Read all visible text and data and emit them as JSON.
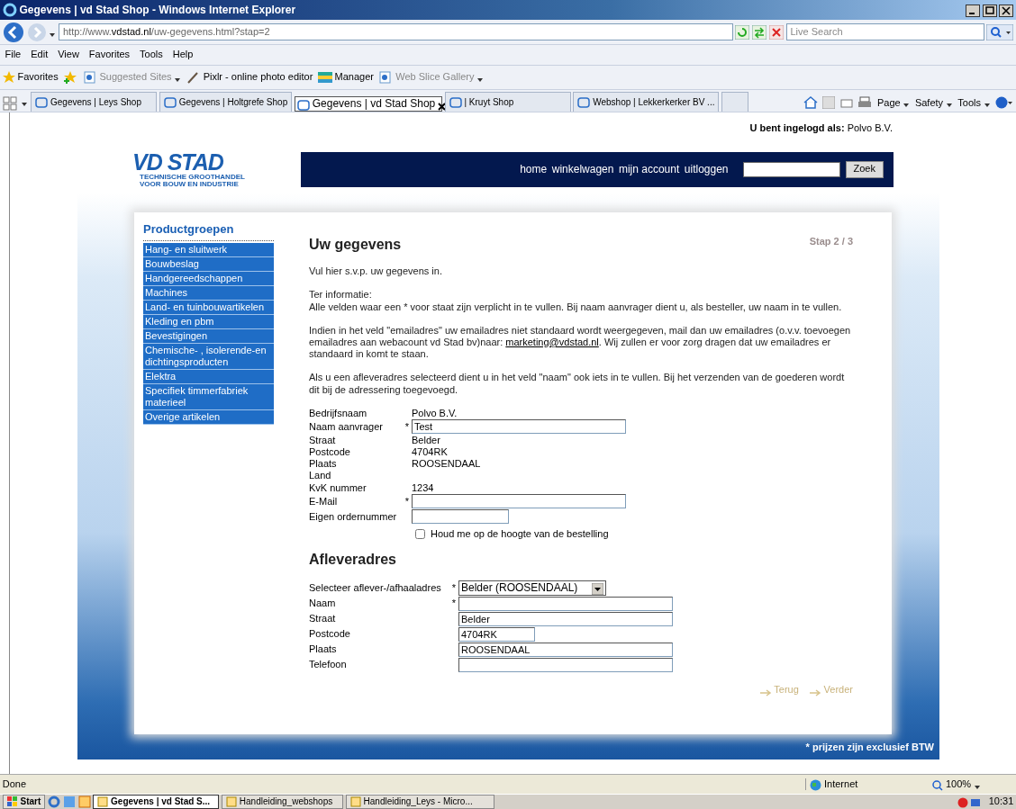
{
  "window": {
    "title": "Gegevens | vd Stad Shop - Windows Internet Explorer"
  },
  "address_bar": {
    "url": "http://www.**vdstad.nl**/uw-gegevens.html?stap=2",
    "search_placeholder": "Live Search"
  },
  "menu": [
    "File",
    "Edit",
    "View",
    "Favorites",
    "Tools",
    "Help"
  ],
  "favorites_bar": {
    "label": "Favorites",
    "items": [
      {
        "label": "Suggested Sites",
        "dropdown": true,
        "dimmed": true
      },
      {
        "label": "Pixlr - online photo editor",
        "dropdown": false,
        "dimmed": false
      },
      {
        "label": "Manager",
        "dropdown": false,
        "dimmed": false
      },
      {
        "label": "Web Slice Gallery",
        "dropdown": true,
        "dimmed": true
      }
    ]
  },
  "tabs": [
    {
      "label": "Gegevens | Leys Shop",
      "selected": false
    },
    {
      "label": "Gegevens | Holtgrefe Shop",
      "selected": false
    },
    {
      "label": "Gegevens | vd Stad Shop",
      "selected": true
    },
    {
      "label": "| Kruyt Shop",
      "selected": false
    },
    {
      "label": "Webshop | Lekkerkerker BV ...",
      "selected": false
    }
  ],
  "command_bar": [
    "Page",
    "Safety",
    "Tools"
  ],
  "page": {
    "login_label": "U bent ingelogd als:",
    "login_user": "Polvo B.V.",
    "logo": {
      "name": "VD STAD",
      "tagline_1": "TECHNISCHE GROOTHANDEL",
      "tagline_2": "VOOR BOUW EN INDUSTRIE"
    },
    "nav": [
      "home",
      "winkelwagen",
      "mijn account",
      "uitloggen"
    ],
    "search_button": "Zoek",
    "sidebar": {
      "title": "Productgroepen",
      "items": [
        "Hang- en sluitwerk",
        "Bouwbeslag",
        "Handgereedschappen",
        "Machines",
        "Land- en tuinbouwartikelen",
        "Kleding en pbm",
        "Bevestigingen",
        "Chemische- , isolerende-en dichtingsproducten",
        "Elektra",
        "Specifiek timmerfabriek materieel",
        "Overige artikelen"
      ]
    },
    "heading": "Uw gegevens",
    "step": "Stap 2 / 3",
    "intro": "Vul hier s.v.p. uw gegevens in.",
    "info_title": "Ter informatie:",
    "info_text": "Alle velden waar een * voor staat zijn verplicht in te vullen. Bij naam aanvrager dient u, als besteller, uw naam in te vullen.",
    "email_note": {
      "before": "Indien in het veld \"emailadres\" uw emailadres niet standaard wordt weergegeven, mail dan uw emailadres (o.v.v. toevoegen emailadres aan webacount vd Stad bv)naar: ",
      "link": "marketing@vdstad.nl",
      "after": ". Wij zullen er voor zorg dragen dat uw emailadres er standaard in komt te staan."
    },
    "address_note": "Als u een afleveradres selecteerd dient u in het veld \"naam\" ook iets in te vullen. Bij het verzenden van de goederen wordt dit bij de adressering toegevoegd.",
    "fields": [
      {
        "kind": "text",
        "label": "Bedrijfsnaam",
        "value": "Polvo B.V."
      },
      {
        "kind": "field",
        "label": "Naam aanvrager",
        "marker": "*",
        "value": "Test"
      },
      {
        "kind": "text",
        "label": "Straat",
        "value": "Belder"
      },
      {
        "kind": "text",
        "label": "Postcode",
        "value": "4704RK"
      },
      {
        "kind": "text",
        "label": "Plaats",
        "value": "ROOSENDAAL"
      },
      {
        "kind": "text",
        "label": "Land"
      },
      {
        "kind": "text",
        "label": "KvK nummer",
        "value": "1234"
      },
      {
        "kind": "field",
        "label": "E-Mail",
        "marker": "*"
      },
      {
        "kind": "short-field",
        "label": "Eigen ordernummer"
      },
      {
        "kind": "checkbox",
        "label": "Houd me op de hoogte van de bestelling",
        "checked": false
      }
    ],
    "delivery_heading": "Afleveradres",
    "delivery_fields": [
      {
        "kind": "select",
        "label": "Selecteer aflever-/afhaaladres",
        "marker": "*",
        "value": "Belder (ROOSENDAAL)"
      },
      {
        "kind": "field",
        "label": "Naam",
        "marker": "*"
      },
      {
        "kind": "field",
        "label": "Straat",
        "value": "Belder"
      },
      {
        "kind": "short-field",
        "label": "Postcode",
        "value": "4704RK"
      },
      {
        "kind": "field",
        "label": "Plaats",
        "value": "ROOSENDAAL"
      },
      {
        "kind": "field",
        "label": "Telefoon"
      }
    ],
    "back": "Terug",
    "next": "Verder",
    "footer": "* prijzen zijn exclusief BTW"
  },
  "status_bar": {
    "text": "Done",
    "zone": "Internet",
    "zoom": "100%"
  },
  "taskbar": {
    "start": "Start",
    "tasks": [
      {
        "label": "Gegevens | vd Stad S...",
        "selected": true
      },
      {
        "label": "Handleiding_webshops",
        "selected": false
      },
      {
        "label": "Handleiding_Leys - Micro...",
        "selected": false
      }
    ],
    "clock": "10:31"
  }
}
